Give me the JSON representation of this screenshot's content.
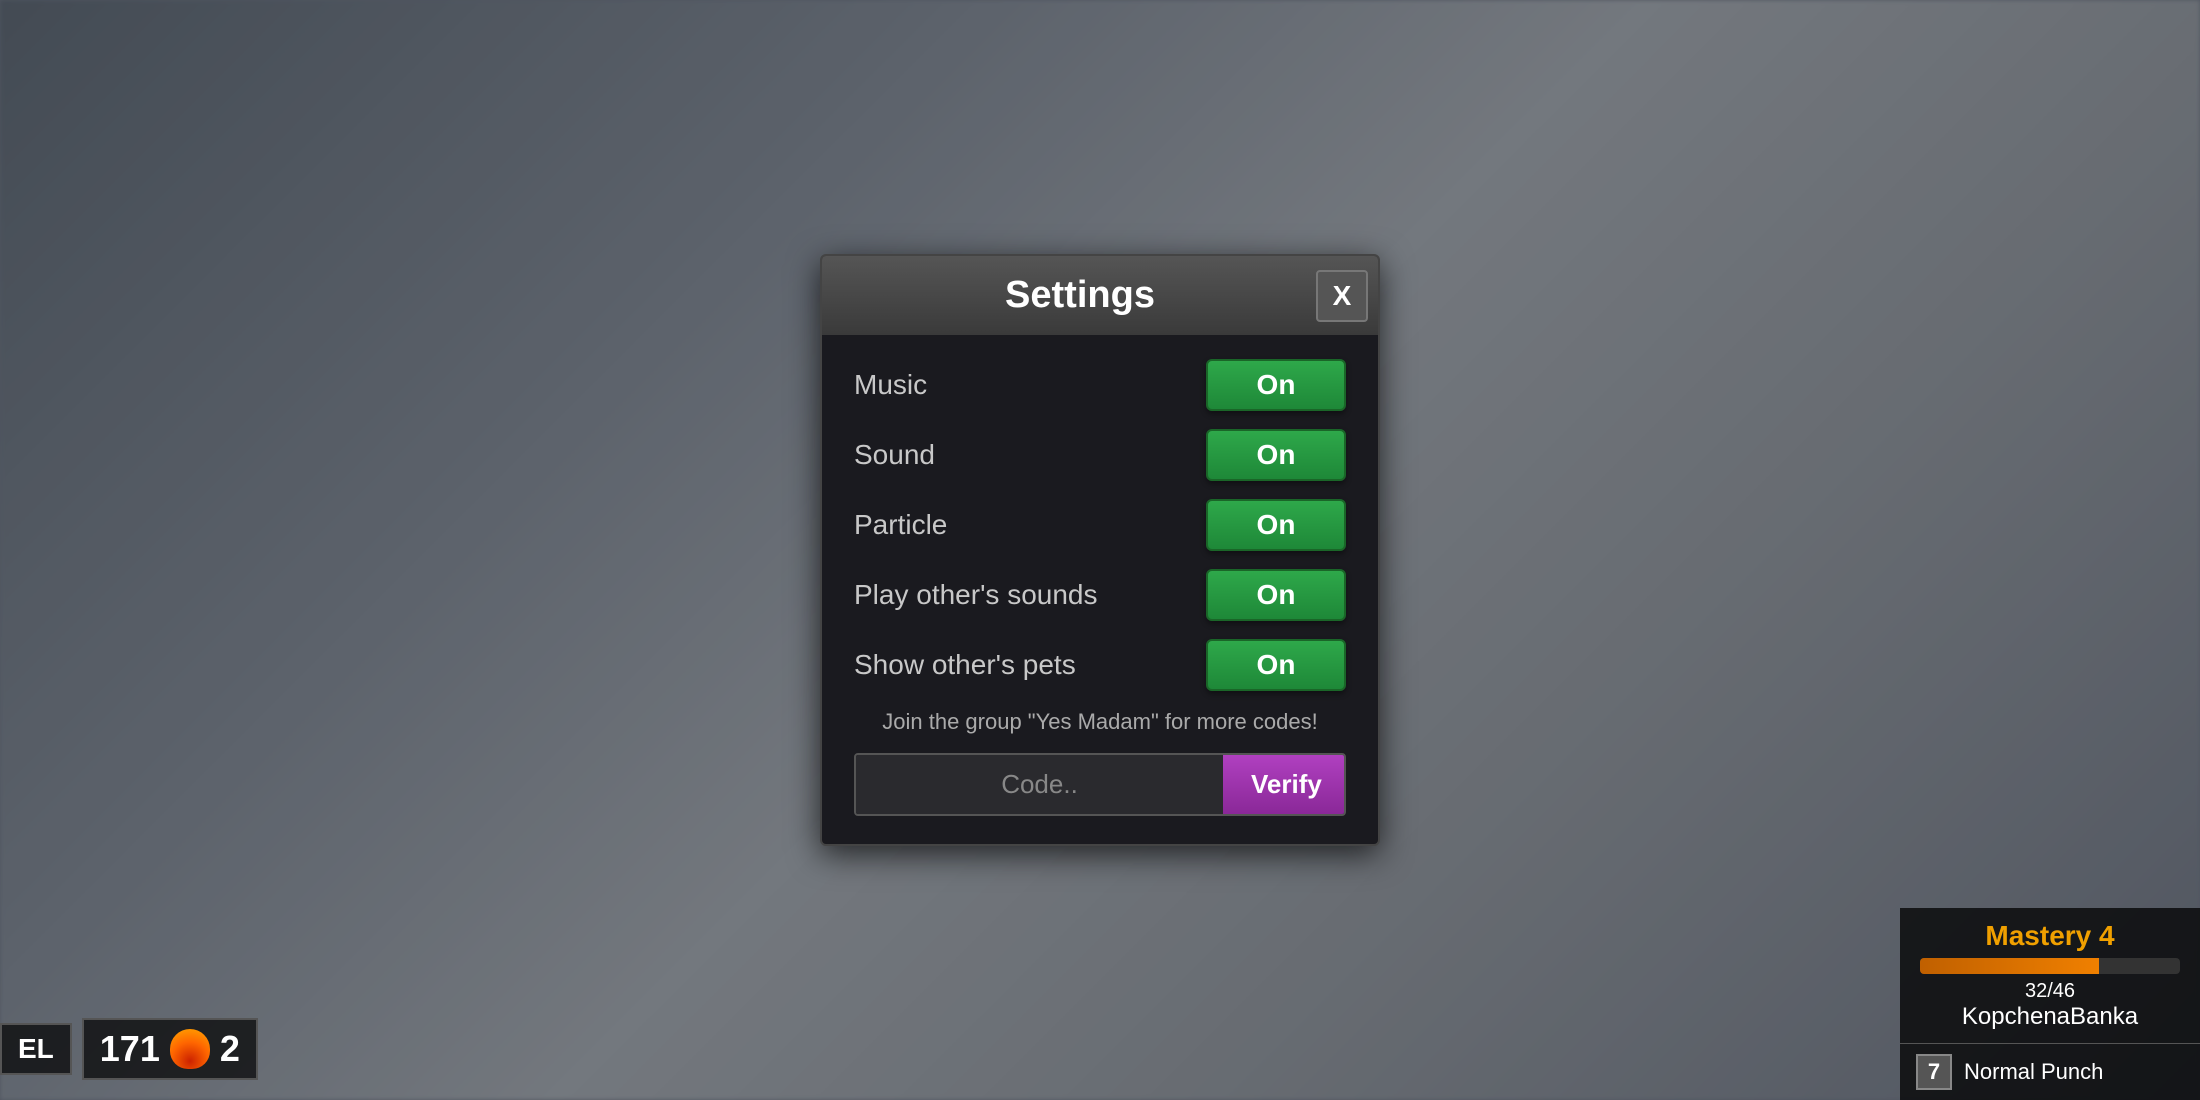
{
  "background": {
    "description": "blurred game street scene"
  },
  "bottomLeft": {
    "levelLabel": "EL",
    "score": "171",
    "kills": "2"
  },
  "bottomRight": {
    "masteryTitle": "Mastery 4",
    "masteryProgress": "32/46",
    "masteryPercent": 69,
    "playerName": "KopchenaBanka",
    "abilityNumber": "7",
    "abilityName": "Normal Punch"
  },
  "settings": {
    "title": "Settings",
    "closeLabel": "X",
    "rows": [
      {
        "label": "Music",
        "value": "On"
      },
      {
        "label": "Sound",
        "value": "On"
      },
      {
        "label": "Particle",
        "value": "On"
      },
      {
        "label": "Play other's sounds",
        "value": "On"
      },
      {
        "label": "Show other's pets",
        "value": "On"
      }
    ],
    "groupMessage": "Join the group \"Yes Madam\" for more codes!",
    "codePlaceholder": "Code..",
    "verifyLabel": "Verify"
  }
}
